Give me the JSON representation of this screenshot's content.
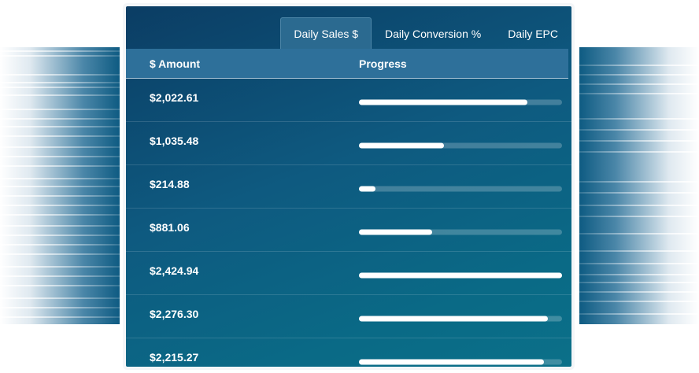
{
  "tabs": [
    {
      "label": "Daily Sales $",
      "active": true
    },
    {
      "label": "Daily Conversion %",
      "active": false
    },
    {
      "label": "Daily EPC",
      "active": false
    }
  ],
  "table": {
    "headers": {
      "amount": "$ Amount",
      "progress": "Progress"
    },
    "rows": [
      {
        "amount": "$2,022.61",
        "progress": 0.83
      },
      {
        "amount": "$1,035.48",
        "progress": 0.42
      },
      {
        "amount": "$214.88",
        "progress": 0.08
      },
      {
        "amount": "$881.06",
        "progress": 0.36
      },
      {
        "amount": "$2,424.94",
        "progress": 1.0
      },
      {
        "amount": "$2,276.30",
        "progress": 0.93
      },
      {
        "amount": "$2,215.27",
        "progress": 0.91
      }
    ]
  }
}
